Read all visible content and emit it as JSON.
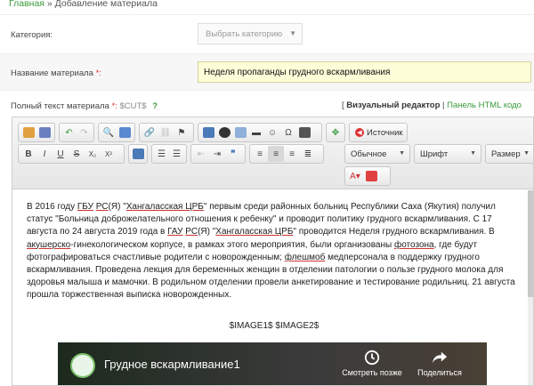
{
  "breadcrumb": {
    "home": "Главная",
    "separator": "»",
    "current": "Добавление материала"
  },
  "category": {
    "label": "Категория:",
    "placeholder": "Выбрать категорию"
  },
  "title_field": {
    "label": "Название материала",
    "required_mark": "*:",
    "value": "Неделя пропаганды грудного вскармливания"
  },
  "text_field": {
    "label": "Полный текст материала",
    "required_mark": "*:",
    "cut_tag": "$CUT$",
    "help": "?"
  },
  "editor_switch": {
    "open_bracket": "[",
    "visual": "Визуальный редактор",
    "divider": "|",
    "html": "Панель HTML кодо"
  },
  "toolbar": {
    "source_label": "Источник",
    "format_select": "Обычное",
    "font_select": "Шрифт",
    "size_select": "Размер",
    "bold": "B",
    "italic": "I",
    "underline": "U",
    "strike": "S",
    "subscript": "X₂",
    "superscript": "X²"
  },
  "content": {
    "p1_a": "В 2016 году ",
    "p1_gbu": "ГБУ",
    "p1_b": " ",
    "p1_rs": "РС",
    "p1_c": "(Я) \"",
    "p1_crb": "Хангаласская ЦРБ",
    "p1_d": "\" первым среди районных больниц Республики Саха (Якутия) получил статус \"Больница доброжелательного отношения к ребенку\" и проводит политику грудного вскармливания. С 17 августа по 24 августа 2019 года в ",
    "p1_gau": "ГАУ",
    "p1_e": " ",
    "p1_rs2": "РС",
    "p1_f": "(Я) \"",
    "p1_crb2": "Хангаласская ЦРБ",
    "p1_g": "\" проводится Неделя грудного вскармливания. В ",
    "p1_ak": "акушерско",
    "p1_h": "-гинекологическом корпусе, в рамках этого мероприятия, были организованы ",
    "p1_foto": "фотозона",
    "p1_i": ", где будут фотографироваться счастливые родители с новорожденным; ",
    "p1_flash": "флешмоб",
    "p1_j": " медперсонала в поддержку грудного вскармливания. Проведена лекция для беременных женщин в отделении патологии о пользе грудного молока для здоровья малыша и мамочки. В родильном отделении провели анкетирование и тестирование родильниц. 21 августа прошла торжественная выписка новорожденных.",
    "images": "$IMAGE1$ $IMAGE2$"
  },
  "video": {
    "title": "Грудное вскармливание1",
    "watch_later": "Смотреть позже",
    "share": "Поделиться"
  },
  "colors": {
    "link_green": "#3a9a3a",
    "input_highlight": "#fdfdd8",
    "required_red": "#e03030"
  }
}
